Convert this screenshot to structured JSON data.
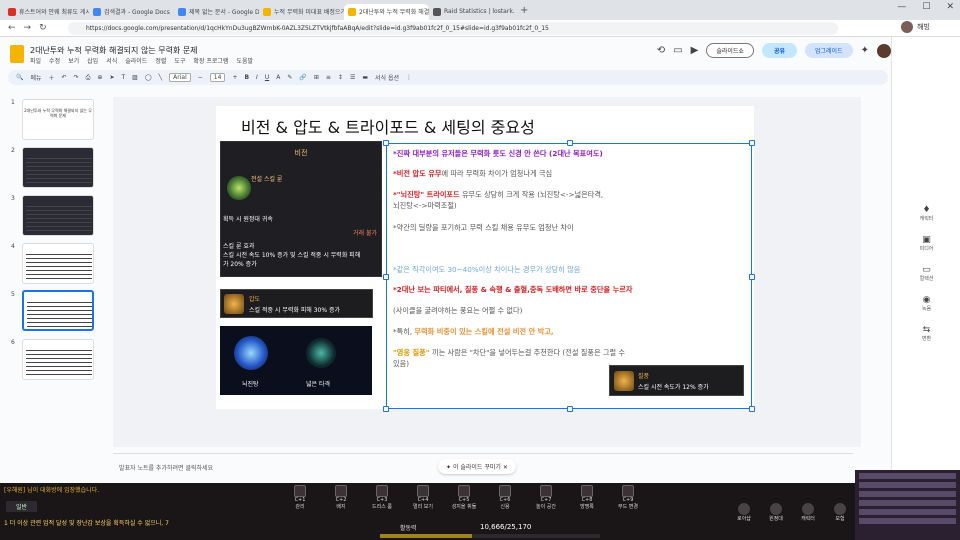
{
  "browser": {
    "tabs": [
      {
        "label": "휴스트어와 안웨 최류도 게시판 - 사...",
        "color": "#d93025"
      },
      {
        "label": "검색결과 - Google Docs",
        "color": "#4285f4"
      },
      {
        "label": "제목 없는 문서 - Google Docs",
        "color": "#4285f4"
      },
      {
        "label": "누적 무력화 미대표 배정으기 Boo...",
        "color": "#f4b400"
      },
      {
        "label": "2대난투와 누적 무력화 해결되지...",
        "color": "#f4b400",
        "active": true
      },
      {
        "label": "Raid Statistics | lostark.bible",
        "color": "#555555"
      }
    ],
    "url": "https://docs.google.com/presentation/d/1qcHkYnDu3ugBZWmbK-0AZL3Z5LZTVtkjfbfaABqA/edit?slide=id.g3f9ab01fc2f_0_15#slide=id.g3f9ab01fc2f_0_15",
    "account": "해빙"
  },
  "app": {
    "doc_title": "2대난투와 누적 무력화 해결되지 않는 무력화 문제",
    "menus": [
      "파일",
      "수정",
      "보기",
      "삽입",
      "서식",
      "슬라이드",
      "정렬",
      "도구",
      "확장 프로그램",
      "도움말"
    ],
    "slideshow_label": "슬라이드쇼",
    "share_label": "공유",
    "upgrade_label": "업그레이드",
    "toolbar": {
      "menu_label": "메뉴",
      "font": "Arial",
      "font_size": "14",
      "format_options": "서식 옵션"
    }
  },
  "thumbnails": [
    {
      "num": "1",
      "text": "2대난투와 누적 무력화 해결되지 않는 무력화 문제"
    },
    {
      "num": "2"
    },
    {
      "num": "3"
    },
    {
      "num": "4"
    },
    {
      "num": "5"
    },
    {
      "num": "6"
    }
  ],
  "slide": {
    "title": "비전 & 압도 & 트라이포드 & 세팅의 중요성",
    "card1": {
      "header": "비전",
      "gem": "전설 스킬 룬",
      "line1": "획득 시 원정대 귀속",
      "line2": "거래 불가",
      "effect": "스킬 룬 효과",
      "effect_text1": "스킬 시전 속도 10% 증가 및 스킬 적중 시 무력화 피해",
      "effect_text2": "가 20% 증가"
    },
    "card2": {
      "name": "압도",
      "desc": "스킬 적중 시 무력화 피해 30% 증가"
    },
    "card3": {
      "label1": "뇌진탕",
      "label2": "넓은 타격"
    },
    "card4": {
      "name": "질풍",
      "desc": "스킬 시전 속도가 12% 증가"
    },
    "lines": {
      "l1": "*진짜 대부분의 유저들은 무력화 룻도 신경 안 쓴다 (2대난 목표여도)",
      "l2a": "*비전 압도 유무",
      "l2b": "에 따라 무력화 차이가 엄청나게 극심",
      "l3a": "*\"뇌진탕\" 트라이포드",
      "l3b": " 유무도 상당히 크게 작용 (뇌진탕<->넓은타격,",
      "l3c": "뇌진탕<->마력조절)",
      "l4": "*약간의 딜량을 포기하고 무력 스킬 채용 유무도 엄청난 차이",
      "l5": "*같은 직각이여도 30~40%이상 차이나는 경우가 상당히 많음",
      "l6": "*2대난 보는 파티에서, 질풍 & 속행 & 출혈,중독 도배하면 바로 중단을 누르자",
      "l7": "(사이클을 굴려야하는 풍요는 어쩔 수 없다)",
      "l8a": "*특히, ",
      "l8b": "무력화 비중이 있는 스킬에 전설 비전 안 박고,",
      "l9a": "\"영웅 질풍\" ",
      "l9b": "끼는 사람은 \"차단\"을",
      "l9c": " 넣어두는걸 추천한다 (전설 질풍은 그럴 수",
      "l10": "있음)"
    },
    "beautify_label": "이 슬라이드 꾸미기",
    "notes_placeholder": "발표자 노트를 추가하려면 클릭하세요"
  },
  "right_sidebar": [
    {
      "icon": "♦",
      "label": "캐릭터"
    },
    {
      "icon": "▣",
      "label": "미디어"
    },
    {
      "icon": "▭",
      "label": "컬렉션"
    },
    {
      "icon": "◉",
      "label": "녹음"
    },
    {
      "icon": "⇆",
      "label": "변환"
    }
  ],
  "game": {
    "chat1": "[우해원] 님이 대화방에 입장했습니다.",
    "channel": "일반",
    "chat3": "1 더 이상 관련 업적 달성 및 장난감 보상을 획득하실 수 없으니, 7",
    "hotkeys": [
      {
        "key": "C+1",
        "label": "관리"
      },
      {
        "key": "C+2",
        "label": "배지"
      },
      {
        "key": "C+3",
        "label": "드리스 룸"
      },
      {
        "key": "C+4",
        "label": "멀리 보기"
      },
      {
        "key": "C+5",
        "label": "성지을 휘둘"
      },
      {
        "key": "C+6",
        "label": "신용"
      },
      {
        "key": "C+7",
        "label": "놀이 공간"
      },
      {
        "key": "C+8",
        "label": "방명록"
      },
      {
        "key": "C+9",
        "label": "무드 변경"
      }
    ],
    "activity_label": "활동력",
    "activity_value": "10,666/25,170",
    "activity_progress": 0.42,
    "menu_icons": [
      "로아샵",
      "원정대",
      "캐릭터",
      "모험"
    ]
  }
}
